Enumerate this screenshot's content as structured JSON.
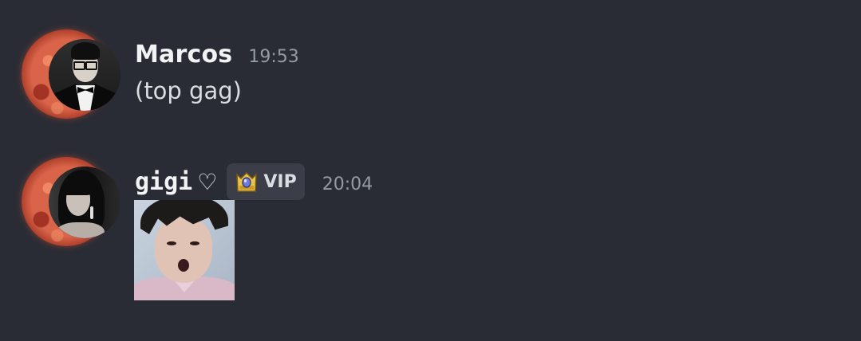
{
  "messages": [
    {
      "author": "Marcos",
      "timestamp": "19:53",
      "text": "(top gag)",
      "avatar_icon": "avatar-tuxedo-glasses-man"
    },
    {
      "author": "gigi",
      "author_suffix": "♡",
      "badge": {
        "label": "VIP",
        "icon": "crown-gem-icon"
      },
      "timestamp": "20:04",
      "attachment_type": "image",
      "avatar_icon": "avatar-dark-haired-woman"
    }
  ],
  "colors": {
    "background": "#2a2c35",
    "username": "#f2f3f5",
    "timestamp": "#949ba4",
    "message_text": "#dbdee1",
    "badge_bg": "#3b3d48",
    "avatar_decoration": "#d9644a"
  }
}
